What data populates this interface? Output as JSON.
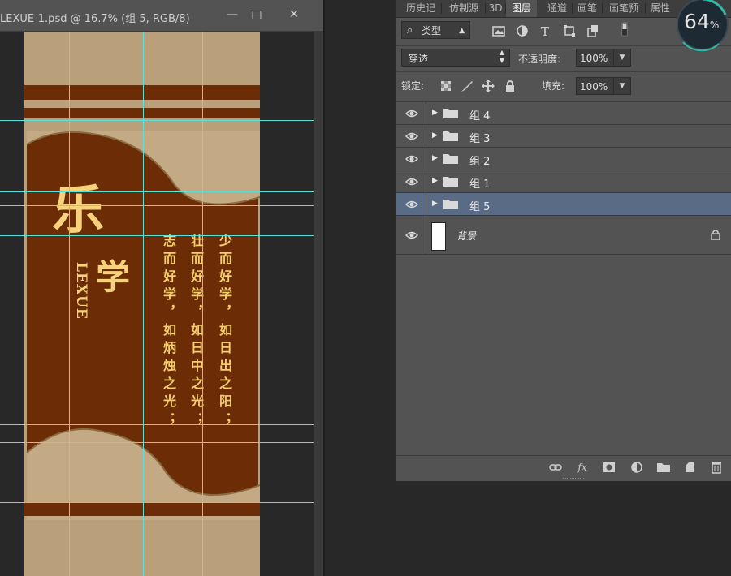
{
  "document": {
    "title": "LEXUE-1.psd @ 16.7% (组 5, RGB/8)",
    "minimize_glyph": "—",
    "maximize_glyph": "□",
    "close_glyph": "✕",
    "artwork": {
      "logo_char": "乐",
      "xue_char": "学",
      "brand_text": "LEXUE",
      "poem_columns": [
        "少而好学，如日出之阳；",
        "壮而好学，如日中之光；",
        "志而好学，如炳烛之光；"
      ],
      "colors": {
        "tan": "#b9a07a",
        "brown": "#6b2c06",
        "gold": "#f6d37a",
        "guide": "#5ce0d8"
      }
    }
  },
  "panel_tabs": [
    {
      "label": "历史记",
      "active": false
    },
    {
      "label": "仿制源",
      "active": false
    },
    {
      "label": "3D",
      "active": false
    },
    {
      "label": "图层",
      "active": true
    },
    {
      "label": "通道",
      "active": false
    },
    {
      "label": "画笔",
      "active": false
    },
    {
      "label": "画笔预",
      "active": false
    },
    {
      "label": "属性",
      "active": false
    }
  ],
  "layers_panel": {
    "filter_kind": "类型",
    "filter_search_glyph": "⌕",
    "blend_mode": "穿透",
    "opacity_label": "不透明度:",
    "opacity_value": "100%",
    "lock_label": "锁定:",
    "fill_label": "填充:",
    "fill_value": "100%",
    "layers": [
      {
        "name": "组 4",
        "type": "group",
        "visible": true,
        "selected": false
      },
      {
        "name": "组 3",
        "type": "group",
        "visible": true,
        "selected": false
      },
      {
        "name": "组 2",
        "type": "group",
        "visible": true,
        "selected": false
      },
      {
        "name": "组 1",
        "type": "group",
        "visible": true,
        "selected": false
      },
      {
        "name": "组 5",
        "type": "group",
        "visible": true,
        "selected": true
      }
    ],
    "background_layer": {
      "name": "背景",
      "locked": true
    },
    "footer_fx": "fx"
  },
  "performance_gauge": {
    "value": "64",
    "unit": "%"
  }
}
